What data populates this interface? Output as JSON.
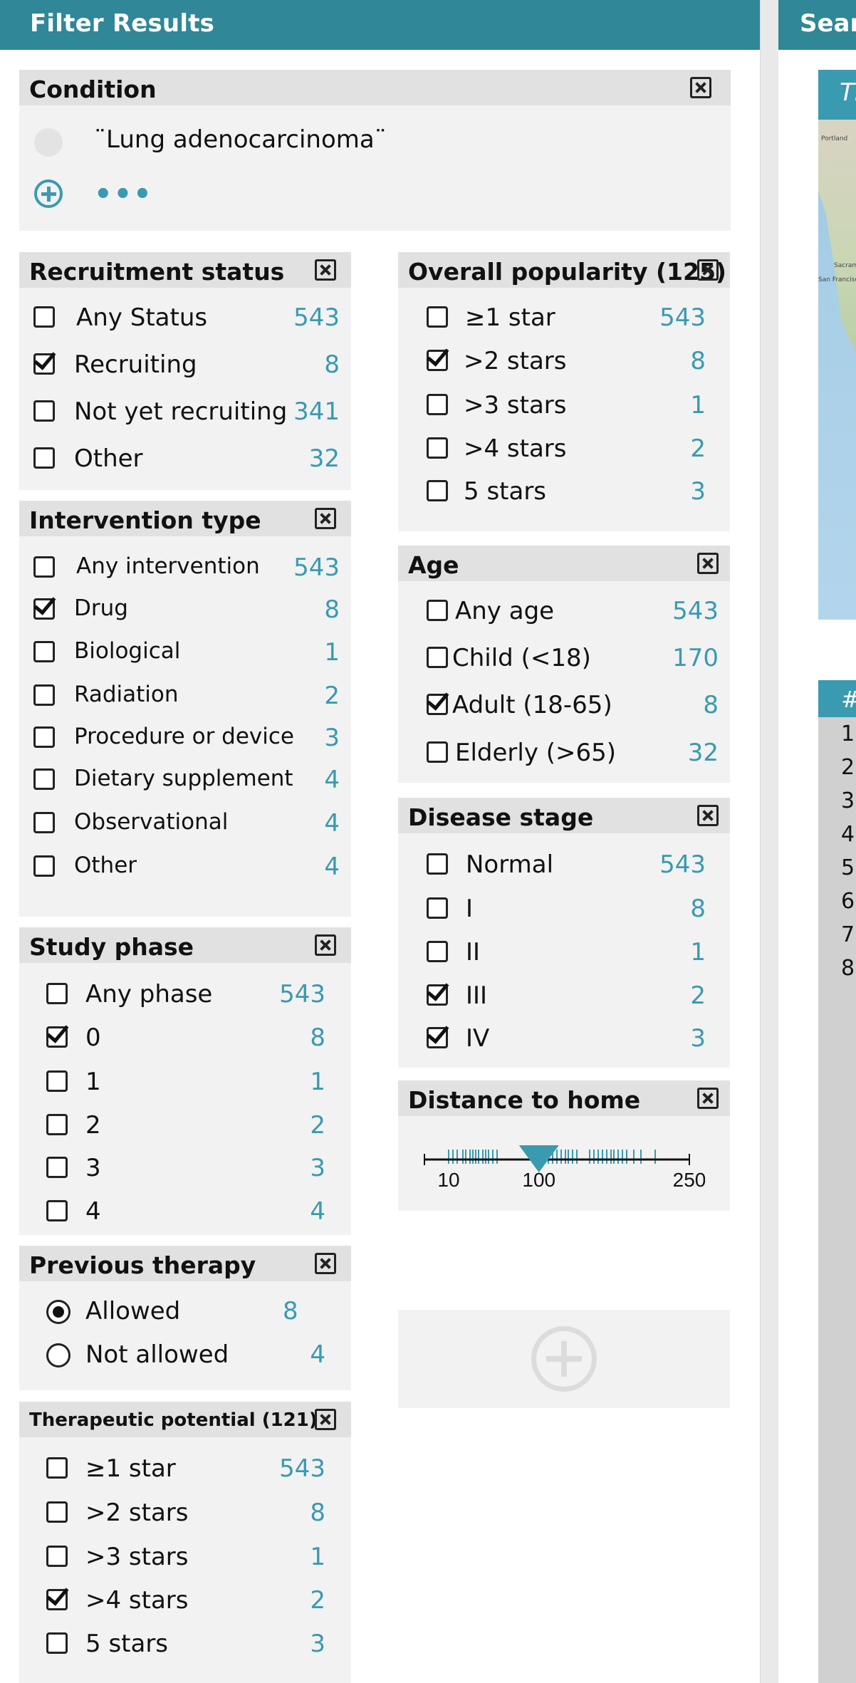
{
  "header": {
    "title": "Filter Results",
    "right_title": "Search"
  },
  "map": {
    "label": "Th",
    "cities": [
      "Portland",
      "Sacram",
      "San Francisco"
    ]
  },
  "results": {
    "col_header": "#",
    "rows": [
      "1",
      "2",
      "3",
      "4",
      "5",
      "6",
      "7",
      "8"
    ]
  },
  "condition": {
    "title": "Condition",
    "value": "¨Lung adenocarcinoma¨",
    "more": "•••"
  },
  "recruitment": {
    "title": "Recruitment status",
    "items": [
      {
        "label": "Any Status",
        "count": "543",
        "checked": false
      },
      {
        "label": "Recruiting",
        "count": "8",
        "checked": true
      },
      {
        "label": "Not yet recruiting",
        "count": "341",
        "checked": false
      },
      {
        "label": "Other",
        "count": "32",
        "checked": false
      }
    ]
  },
  "intervention": {
    "title": "Intervention type",
    "items": [
      {
        "label": "Any intervention",
        "count": "543",
        "checked": false
      },
      {
        "label": "Drug",
        "count": "8",
        "checked": true
      },
      {
        "label": "Biological",
        "count": "1",
        "checked": false
      },
      {
        "label": "Radiation",
        "count": "2",
        "checked": false
      },
      {
        "label": "Procedure or device",
        "count": "3",
        "checked": false
      },
      {
        "label": "Dietary supplement",
        "count": "4",
        "checked": false
      },
      {
        "label": "Observational",
        "count": "4",
        "checked": false
      },
      {
        "label": "Other",
        "count": "4",
        "checked": false
      }
    ]
  },
  "phase": {
    "title": "Study phase",
    "items": [
      {
        "label": "Any phase",
        "count": "543",
        "checked": false
      },
      {
        "label": "0",
        "count": "8",
        "checked": true
      },
      {
        "label": "1",
        "count": "1",
        "checked": false
      },
      {
        "label": "2",
        "count": "2",
        "checked": false
      },
      {
        "label": "3",
        "count": "3",
        "checked": false
      },
      {
        "label": "4",
        "count": "4",
        "checked": false
      }
    ]
  },
  "therapy": {
    "title": "Previous therapy",
    "items": [
      {
        "label": "Allowed",
        "count": "8",
        "selected": true
      },
      {
        "label": "Not allowed",
        "count": "4",
        "selected": false
      }
    ]
  },
  "therapeutic": {
    "title": "Therapeutic potential (121)",
    "items": [
      {
        "label": "≥1 star",
        "count": "543",
        "checked": false
      },
      {
        "label": ">2 stars",
        "count": "8",
        "checked": false
      },
      {
        "label": ">3 stars",
        "count": "1",
        "checked": false
      },
      {
        "label": ">4 stars",
        "count": "2",
        "checked": true
      },
      {
        "label": "5 stars",
        "count": "3",
        "checked": false
      }
    ]
  },
  "popularity": {
    "title": "Overall popularity (125)",
    "items": [
      {
        "label": "≥1 star",
        "count": "543",
        "checked": false
      },
      {
        "label": ">2 stars",
        "count": "8",
        "checked": true
      },
      {
        "label": ">3 stars",
        "count": "1",
        "checked": false
      },
      {
        "label": ">4 stars",
        "count": "2",
        "checked": false
      },
      {
        "label": "5 stars",
        "count": "3",
        "checked": false
      }
    ]
  },
  "age": {
    "title": "Age",
    "items": [
      {
        "label": "Any age",
        "count": "543",
        "checked": false
      },
      {
        "label": "Child (<18)",
        "count": "170",
        "checked": false
      },
      {
        "label": "Adult (18-65)",
        "count": "8",
        "checked": true
      },
      {
        "label": "Elderly (>65)",
        "count": "32",
        "checked": false
      }
    ]
  },
  "stage": {
    "title": "Disease stage",
    "items": [
      {
        "label": "Normal",
        "count": "543",
        "checked": false
      },
      {
        "label": "I",
        "count": "8",
        "checked": false
      },
      {
        "label": "II",
        "count": "1",
        "checked": false
      },
      {
        "label": "III",
        "count": "2",
        "checked": true
      },
      {
        "label": "IV",
        "count": "3",
        "checked": true
      }
    ]
  },
  "distance": {
    "title": "Distance to home",
    "min_label": "10",
    "value_label": "100",
    "max_label": "250",
    "min": 10,
    "max": 250,
    "value": 100
  },
  "colors": {
    "header": "#2f8797",
    "accent": "#3a9ab0",
    "panel": "#f2f2f2",
    "panel_head": "#e1e1e1"
  }
}
